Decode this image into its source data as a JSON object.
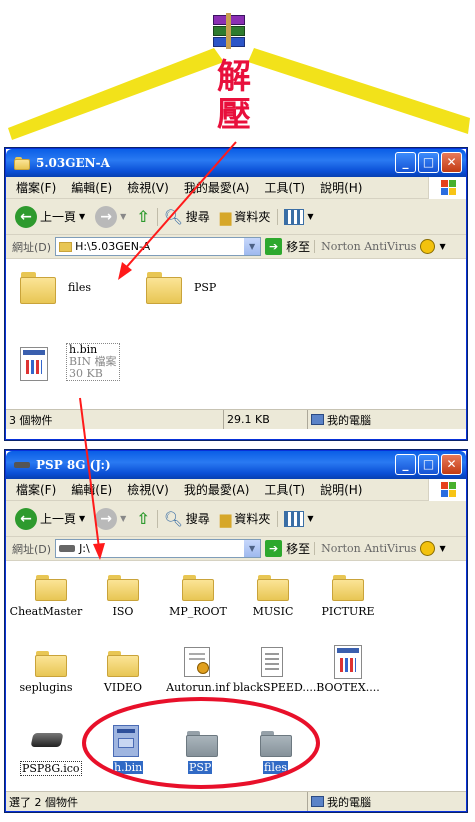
{
  "annotation": {
    "label_line1": "解",
    "label_line2": "壓",
    "colors": {
      "roof": "#f2e21a",
      "label": "#e8103c",
      "arrow": "#ff1a1a",
      "ellipse": "#e8102a"
    },
    "winrar_icon": "winrar-books-icon"
  },
  "menu": [
    "檔案(F)",
    "編輯(E)",
    "檢視(V)",
    "我的最愛(A)",
    "工具(T)",
    "說明(H)"
  ],
  "toolbar": {
    "back": "上一頁",
    "search": "搜尋",
    "folders": "資料夾"
  },
  "address": {
    "label": "網址(D)",
    "go": "移至",
    "norton": "Norton AntiVirus"
  },
  "window1": {
    "title": "5.03GEN-A",
    "path": "H:\\5.03GEN-A",
    "items": [
      {
        "name": "files",
        "type": "folder"
      },
      {
        "name": "PSP",
        "type": "folder"
      }
    ],
    "file": {
      "name": "h.bin",
      "type": "BIN 檔案",
      "size": "30 KB"
    },
    "status": {
      "count": "3 個物件",
      "size": "29.1 KB",
      "location": "我的電腦"
    }
  },
  "window2": {
    "title": "PSP 8G  (J:)",
    "path": "J:\\",
    "row1": [
      "CheatMaster",
      "ISO",
      "MP_ROOT",
      "MUSIC",
      "PICTURE"
    ],
    "row2": [
      "seplugins",
      "VIDEO",
      "Autorun.inf",
      "blackSPEED....",
      "BOOTEX...."
    ],
    "row3": [
      "PSP8G.ico",
      "h.bin",
      "PSP",
      "files"
    ],
    "status": {
      "count": "選了 2 個物件",
      "location": "我的電腦"
    }
  }
}
